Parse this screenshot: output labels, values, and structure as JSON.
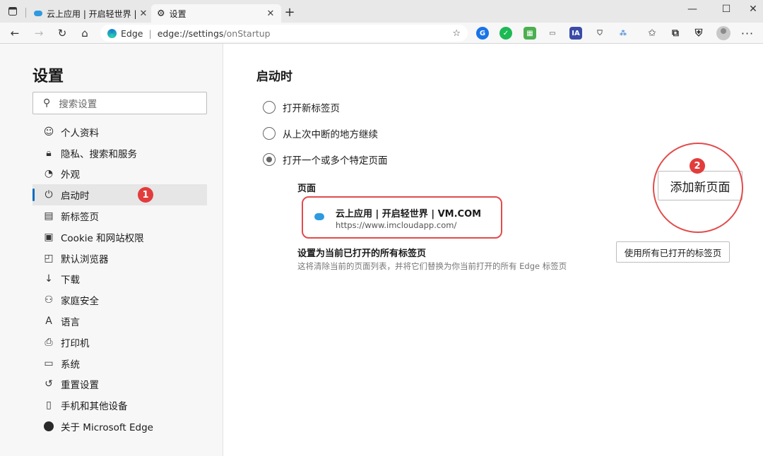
{
  "browser": {
    "tabs": [
      {
        "label": "云上应用 | 开启轻世界 | VM.COM",
        "active": false
      },
      {
        "label": "设置",
        "active": true
      }
    ],
    "address": {
      "brand": "Edge",
      "scheme": "edge://settings",
      "path": "/onStartup"
    }
  },
  "sidebar": {
    "title": "设置",
    "search_placeholder": "搜索设置",
    "items": [
      {
        "label": "个人资料",
        "icon": "profile-icon"
      },
      {
        "label": "隐私、搜索和服务",
        "icon": "lock-icon"
      },
      {
        "label": "外观",
        "icon": "palette-icon"
      },
      {
        "label": "启动时",
        "icon": "power-icon",
        "active": true
      },
      {
        "label": "新标签页",
        "icon": "new-tab-icon"
      },
      {
        "label": "Cookie 和网站权限",
        "icon": "site-permissions-icon"
      },
      {
        "label": "默认浏览器",
        "icon": "browser-icon"
      },
      {
        "label": "下载",
        "icon": "download-icon"
      },
      {
        "label": "家庭安全",
        "icon": "family-icon"
      },
      {
        "label": "语言",
        "icon": "language-icon"
      },
      {
        "label": "打印机",
        "icon": "printer-icon"
      },
      {
        "label": "系统",
        "icon": "laptop-icon"
      },
      {
        "label": "重置设置",
        "icon": "reset-icon"
      },
      {
        "label": "手机和其他设备",
        "icon": "phone-icon"
      },
      {
        "label": "关于 Microsoft Edge",
        "icon": "edge-logo-icon"
      }
    ]
  },
  "main": {
    "title": "启动时",
    "options": [
      {
        "label": "打开新标签页",
        "checked": false
      },
      {
        "label": "从上次中断的地方继续",
        "checked": false
      },
      {
        "label": "打开一个或多个特定页面",
        "checked": true
      }
    ],
    "pages_label": "页面",
    "add_page_button": "添加新页面",
    "page_entry": {
      "title": "云上应用 | 开启轻世界 | VM.COM",
      "url": "https://www.imcloudapp.com/"
    },
    "use_open_tabs": {
      "title": "设置为当前已打开的所有标签页",
      "description": "这将清除当前的页面列表，并将它们替换为你当前打开的所有 Edge 标签页",
      "button": "使用所有已打开的标签页"
    }
  },
  "annotations": {
    "badge_1": "1",
    "badge_2": "2"
  }
}
